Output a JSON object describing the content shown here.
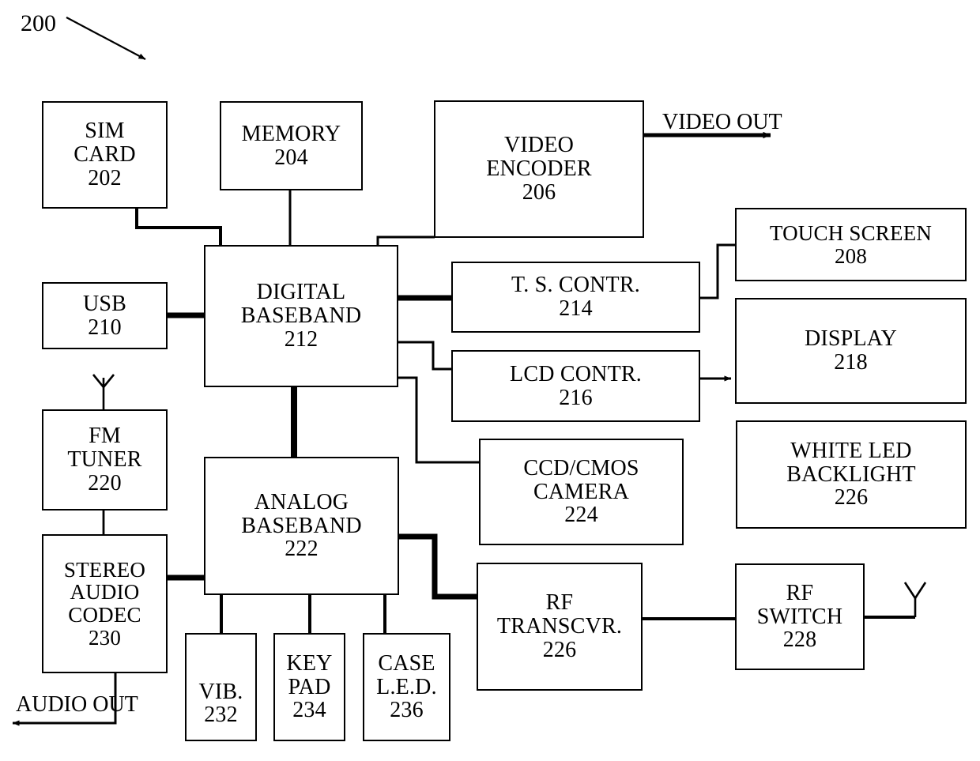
{
  "figure": {
    "number": "200",
    "type": "patent-block-diagram",
    "description": "Mobile handset system block diagram"
  },
  "labels": {
    "video_out": [
      "VIDEO",
      "OUT"
    ],
    "audio_out": [
      "AUDIO",
      "OUT"
    ]
  },
  "blocks": [
    {
      "id": "sim_card",
      "lines": [
        "SIM",
        "CARD",
        "202"
      ],
      "ref": "202"
    },
    {
      "id": "memory",
      "lines": [
        "MEMORY",
        "204"
      ],
      "ref": "204"
    },
    {
      "id": "video_encoder",
      "lines": [
        "VIDEO",
        "ENCODER",
        "206"
      ],
      "ref": "206"
    },
    {
      "id": "touch_screen",
      "lines": [
        "TOUCH SCREEN",
        "208"
      ],
      "ref": "208"
    },
    {
      "id": "usb",
      "lines": [
        "USB",
        "210"
      ],
      "ref": "210"
    },
    {
      "id": "digital_baseband",
      "lines": [
        "DIGITAL",
        "BASEBAND",
        "212"
      ],
      "ref": "212"
    },
    {
      "id": "ts_contr",
      "lines": [
        "T. S. CONTR.",
        "214"
      ],
      "ref": "214"
    },
    {
      "id": "lcd_contr",
      "lines": [
        "LCD CONTR.",
        "216"
      ],
      "ref": "216"
    },
    {
      "id": "display",
      "lines": [
        "DISPLAY",
        "218"
      ],
      "ref": "218"
    },
    {
      "id": "fm_tuner",
      "lines": [
        "FM",
        "TUNER",
        "220"
      ],
      "ref": "220"
    },
    {
      "id": "analog_baseband",
      "lines": [
        "ANALOG",
        "BASEBAND",
        "222"
      ],
      "ref": "222"
    },
    {
      "id": "camera",
      "lines": [
        "CCD/CMOS",
        "CAMERA",
        "224"
      ],
      "ref": "224"
    },
    {
      "id": "white_led",
      "lines": [
        "WHITE LED",
        "BACKLIGHT",
        "226"
      ],
      "ref": "226"
    },
    {
      "id": "rf_transcvr",
      "lines": [
        "RF",
        "TRANSCVR.",
        "226"
      ],
      "ref": "226"
    },
    {
      "id": "rf_switch",
      "lines": [
        "RF",
        "SWITCH",
        "228"
      ],
      "ref": "228"
    },
    {
      "id": "stereo_codec",
      "lines": [
        "STEREO",
        "AUDIO",
        "CODEC",
        "230"
      ],
      "ref": "230"
    },
    {
      "id": "vib",
      "lines": [
        "VIB.",
        "232"
      ],
      "ref": "232"
    },
    {
      "id": "key_pad",
      "lines": [
        "KEY",
        "PAD",
        "234"
      ],
      "ref": "234"
    },
    {
      "id": "case_led",
      "lines": [
        "CASE",
        "L.E.D.",
        "236"
      ],
      "ref": "236"
    }
  ],
  "colors": {
    "stroke": "#000000",
    "background": "#ffffff"
  }
}
